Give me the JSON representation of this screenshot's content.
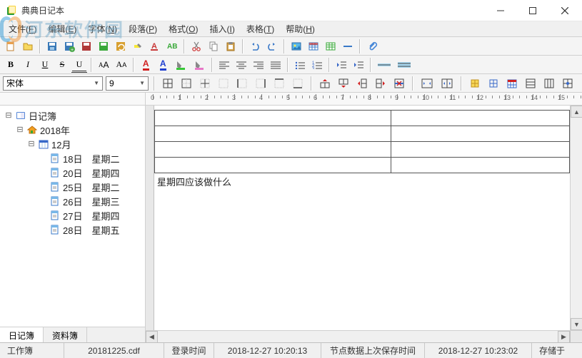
{
  "window": {
    "title": "典典日记本"
  },
  "menus": [
    {
      "label": "文件",
      "key": "F"
    },
    {
      "label": "编辑",
      "key": "E"
    },
    {
      "label": "字体",
      "key": "N"
    },
    {
      "label": "段落",
      "key": "P"
    },
    {
      "label": "格式",
      "key": "O"
    },
    {
      "label": "插入",
      "key": "I"
    },
    {
      "label": "表格",
      "key": "T"
    },
    {
      "label": "帮助",
      "key": "H"
    }
  ],
  "font": {
    "name": "宋体",
    "size": "9"
  },
  "tree": {
    "root": "日记簿",
    "year": "2018年",
    "month": "12月",
    "days": [
      {
        "d": "18日",
        "w": "星期二"
      },
      {
        "d": "20日",
        "w": "星期四"
      },
      {
        "d": "25日",
        "w": "星期二"
      },
      {
        "d": "26日",
        "w": "星期三"
      },
      {
        "d": "27日",
        "w": "星期四"
      },
      {
        "d": "28日",
        "w": "星期五"
      }
    ]
  },
  "side_tabs": {
    "active": "日记簿",
    "inactive": "资料簿"
  },
  "document": {
    "body_text": "星期四应该做什么"
  },
  "status": {
    "workbook": "工作簿",
    "file": "20181225.cdf",
    "login_label": "登录时间",
    "login_time": "2018-12-27 10:20:13",
    "save_label": "节点数据上次保存时间",
    "save_time": "2018-12-27 10:23:02",
    "storage": "存储于"
  },
  "watermark": {
    "text": "河东软件园"
  }
}
